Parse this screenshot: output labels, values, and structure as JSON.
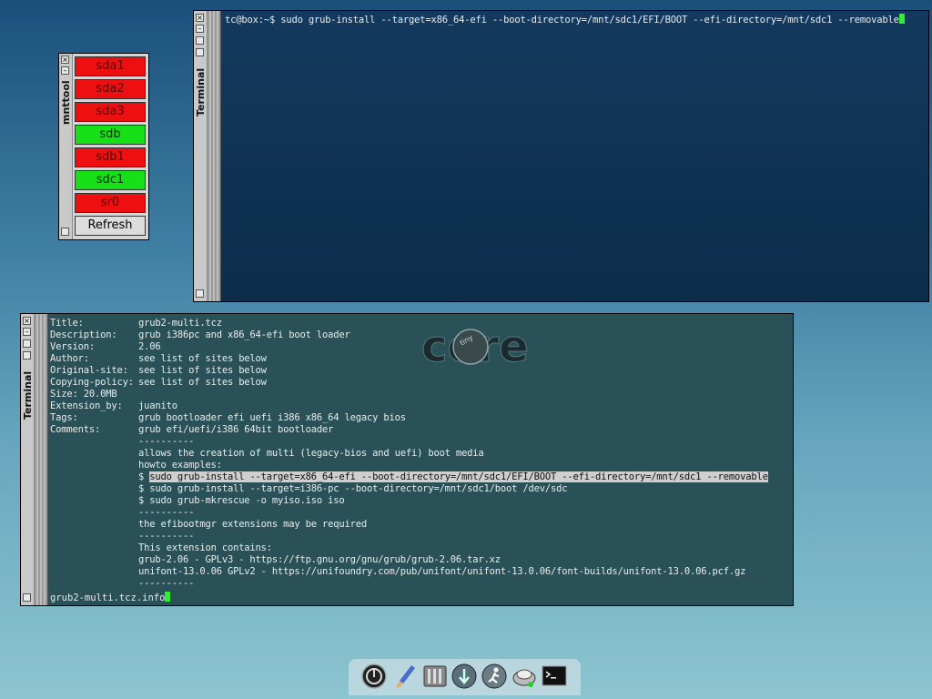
{
  "mnttool": {
    "title": "mnttool",
    "devices": [
      {
        "label": "sda1",
        "state": "unmounted"
      },
      {
        "label": "sda2",
        "state": "unmounted"
      },
      {
        "label": "sda3",
        "state": "unmounted"
      },
      {
        "label": "sdb",
        "state": "mounted"
      },
      {
        "label": "sdb1",
        "state": "unmounted"
      },
      {
        "label": "sdc1",
        "state": "mounted"
      },
      {
        "label": "sr0",
        "state": "unmounted"
      }
    ],
    "refresh_label": "Refresh"
  },
  "terminal_top": {
    "title": "Terminal",
    "command_line": "tc@box:~$ sudo grub-install --target=x86_64-efi --boot-directory=/mnt/sdc1/EFI/BOOT --efi-directory=/mnt/sdc1 --removable"
  },
  "terminal_bottom": {
    "title": "Terminal",
    "info_rows": [
      {
        "key": "Title:",
        "value": "grub2-multi.tcz"
      },
      {
        "key": "Description:",
        "value": "grub i386pc and x86_64-efi boot loader"
      },
      {
        "key": "Version:",
        "value": "2.06"
      },
      {
        "key": "Author:",
        "value": "see list of sites below"
      },
      {
        "key": "Original-site:",
        "value": "see list of sites below"
      },
      {
        "key": "Copying-policy:",
        "value": "see list of sites below"
      },
      {
        "key": "Size: 20.0MB",
        "value": ""
      },
      {
        "key": "Extension_by:",
        "value": "juanito"
      },
      {
        "key": "Tags:",
        "value": "grub bootloader efi uefi i386 x86_64 legacy bios"
      },
      {
        "key": "Comments:",
        "value": "grub efi/uefi/i386 64bit bootloader"
      },
      {
        "key": "",
        "value": "----------"
      },
      {
        "key": "",
        "value": "allows the creation of multi (legacy-bios and uefi) boot media"
      },
      {
        "key": "",
        "value": "howto examples:"
      }
    ],
    "example_prompt": "$ ",
    "example_highlighted": "sudo grub-install --target=x86_64-efi --boot-directory=/mnt/sdc1/EFI/BOOT --efi-directory=/mnt/sdc1 --removable",
    "tail_rows": [
      "$ sudo grub-install --target=i386-pc --boot-directory=/mnt/sdc1/boot /dev/sdc",
      "$ sudo grub-mkrescue -o myiso.iso iso",
      "----------",
      "the efibootmgr extensions may be required",
      "----------",
      "This extension contains:",
      "grub-2.06 - GPLv3 - https://ftp.gnu.org/gnu/grub/grub-2.06.tar.xz",
      "unifont-13.0.06 GPLv2 - https://unifoundry.com/pub/unifont/unifont-13.0.06/font-builds/unifont-13.0.06.pcf.gz",
      "----------"
    ],
    "status_line": "grub2-multi.tcz.info",
    "logo_text": "core",
    "logo_small_text": "tiny"
  },
  "dock": {
    "icons": [
      "power-icon",
      "brush-icon",
      "control-panel-icon",
      "apps-icon",
      "run-icon",
      "mount-icon",
      "terminal-icon"
    ]
  },
  "colors": {
    "mounted": "#18e018",
    "unmounted": "#ee1010",
    "cursor": "#2ef02e"
  }
}
